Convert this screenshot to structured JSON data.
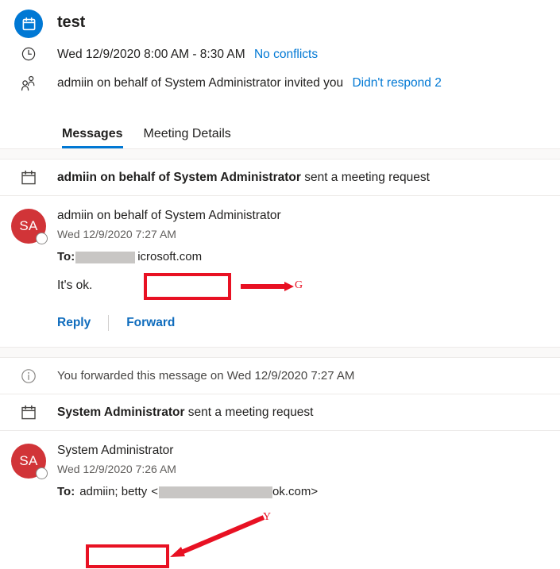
{
  "header": {
    "title": "test",
    "calendar_icon": "calendar-icon",
    "clock_icon": "clock-icon",
    "people_icon": "people-icon",
    "time_text": "Wed 12/9/2020 8:00 AM - 8:30 AM",
    "conflicts_link": "No conflicts",
    "organizer_text": "admiin on behalf of System Administrator invited you",
    "response_link": "Didn't respond 2"
  },
  "tabs": [
    {
      "label": "Messages",
      "active": true
    },
    {
      "label": "Meeting Details",
      "active": false
    }
  ],
  "thread": {
    "system_row_1": {
      "icon": "calendar-icon",
      "bold": "admiin on behalf of System Administrator",
      "rest": " sent a meeting request"
    },
    "message_1": {
      "avatar_initials": "SA",
      "sender": "admiin on behalf of System Administrator",
      "timestamp": "Wed 12/9/2020 7:27 AM",
      "to_label": "To:",
      "to_redacted": true,
      "to_visible": "icrosoft.com",
      "body": "It's ok.",
      "reply_label": "Reply",
      "forward_label": "Forward"
    },
    "forwarded_notice": {
      "icon": "info-icon",
      "text": "You forwarded this message on Wed 12/9/2020 7:27 AM"
    },
    "system_row_2": {
      "icon": "calendar-icon",
      "bold": "System Administrator",
      "rest": " sent a meeting request"
    },
    "message_2": {
      "avatar_initials": "SA",
      "sender": "System Administrator",
      "timestamp": "Wed 12/9/2020 7:26 AM",
      "to_label": "To:",
      "to_highlighted": "admiin; betty",
      "to_bracket_open": "<",
      "to_visible_tail": "ok.com>"
    }
  },
  "annotations": {
    "g_label": "G",
    "y_label": "Y",
    "color": "#e81123"
  },
  "colors": {
    "accent": "#0078d4",
    "link": "#0f6cbd",
    "avatar": "#d13438",
    "annotation": "#e81123",
    "band": "#faf9f8",
    "divider": "#edebe9"
  }
}
